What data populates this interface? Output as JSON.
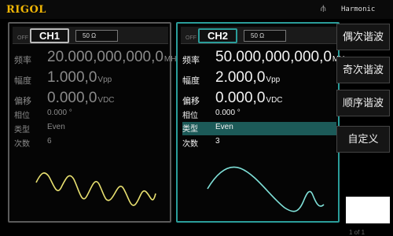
{
  "header": {
    "brand": "RIGOL",
    "usb_icon": "usb-icon",
    "mode": "Harmonic"
  },
  "channels": [
    {
      "label": "CH1",
      "off": "OFF",
      "impedance": "50 Ω",
      "freq": {
        "label": "频率",
        "value": "20.000,000,000,0",
        "unit": "MHz"
      },
      "amp": {
        "label": "幅度",
        "value": "1.000,0",
        "unit": "Vpp"
      },
      "offset": {
        "label": "偏移",
        "value": "0.000,0",
        "unit": "VDC"
      },
      "phase": {
        "label": "相位",
        "value": "0.000 °"
      },
      "type": {
        "label": "类型",
        "value": "Even"
      },
      "order": {
        "label": "次数",
        "value": "6"
      }
    },
    {
      "label": "CH2",
      "off": "OFF",
      "impedance": "50 Ω",
      "freq": {
        "label": "频率",
        "value": "50.000,000,000,0",
        "unit": "MHz"
      },
      "amp": {
        "label": "幅度",
        "value": "2.000,0",
        "unit": "Vpp"
      },
      "offset": {
        "label": "偏移",
        "value": "0.000,0",
        "unit": "VDC"
      },
      "phase": {
        "label": "相位",
        "value": "0.000 °"
      },
      "type": {
        "label": "类型",
        "value": "Even"
      },
      "order": {
        "label": "次数",
        "value": "3"
      }
    }
  ],
  "softkeys": [
    "偶次谐波",
    "奇次谐波",
    "顺序谐波",
    "自定义"
  ],
  "footer": "1 of 1",
  "colors": {
    "brand": "#f2b705",
    "ch2_accent": "#2a9d9a",
    "wave_yellow": "#e8e070",
    "wave_cyan": "#7fe0d8",
    "highlight": "#1c5a58"
  }
}
